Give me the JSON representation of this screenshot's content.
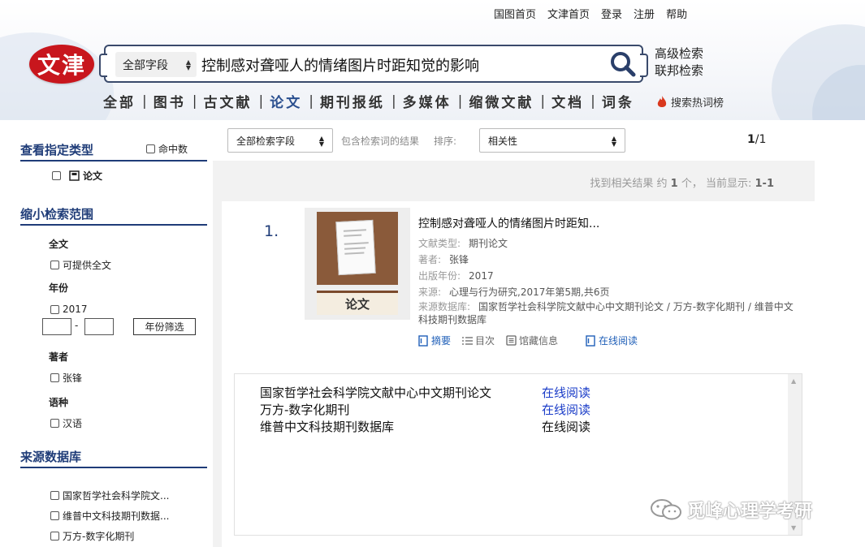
{
  "top_links": [
    "国图首页",
    "文津首页",
    "登录",
    "注册",
    "帮助"
  ],
  "logo_text": "文津",
  "search": {
    "field": "全部字段",
    "query": "控制感对聋哑人的情绪图片时距知觉的影响"
  },
  "advanced": {
    "adv_search": "高级检索",
    "federated_search": "联邦检索"
  },
  "nav_tabs": [
    "全部",
    "图书",
    "古文献",
    "论文",
    "期刊报纸",
    "多媒体",
    "缩微文献",
    "文档",
    "词条"
  ],
  "nav_active": "论文",
  "hot_search": "搜索热词榜",
  "sidebar": {
    "type_title": "查看指定类型",
    "hit_count_label": "命中数",
    "type_item": "论文",
    "narrow_title": "缩小检索范围",
    "fulltext_label": "全文",
    "fulltext_item": "可提供全文",
    "year_label": "年份",
    "year_item": "2017",
    "year_sep": "-",
    "year_filter_btn": "年份筛选",
    "author_label": "著者",
    "author_item": "张锋",
    "lang_label": "语种",
    "lang_item": "汉语",
    "source_title": "来源数据库",
    "sources": [
      "国家哲学社会科学院文...",
      "维普中文科技期刊数据...",
      "万方-数字化期刊"
    ]
  },
  "toolbar": {
    "field_select": "全部检索字段",
    "include_text": "包含检索词的结果",
    "sort_label": "排序:",
    "sort_value": "相关性",
    "page_current": "1",
    "page_total": "/1"
  },
  "found": {
    "prefix": "找到相关结果 约",
    "count": "1",
    "suffix": "个，  当前显示:",
    "range": "1-1"
  },
  "result": {
    "index": "1.",
    "cover_label": "论文",
    "title": "控制感对聋哑人的情绪图片时距知...",
    "meta": [
      {
        "key": "文献类型:",
        "value": "期刊论文"
      },
      {
        "key": "著者:",
        "value": "张锋"
      },
      {
        "key": "出版年份:",
        "value": "2017"
      },
      {
        "key": "来源:",
        "value": "心理与行为研究,2017年第5期,共6页"
      },
      {
        "key": "来源数据库:",
        "value": "国家哲学社会科学院文献中心中文期刊论文 / 万方-数字化期刊 / 维普中文科技期刊数据库"
      }
    ],
    "actions": [
      "摘要",
      "目次",
      "馆藏信息",
      "在线阅读"
    ]
  },
  "panel_rows": [
    {
      "source": "国家哲学社会科学院文献中心中文期刊论文",
      "link": "在线阅读",
      "link_color": "#1a3cc8"
    },
    {
      "source": "万方-数字化期刊",
      "link": "在线阅读",
      "link_color": "#1a3cc8"
    },
    {
      "source": "维普中文科技期刊数据库",
      "link": "在线阅读",
      "link_color": "#111111"
    }
  ],
  "watermark": "觅峰心理学考研",
  "colors": {
    "nav_blue": "#1f3c78",
    "link_blue": "#1f5fb8",
    "logo_red": "#c8161d"
  }
}
